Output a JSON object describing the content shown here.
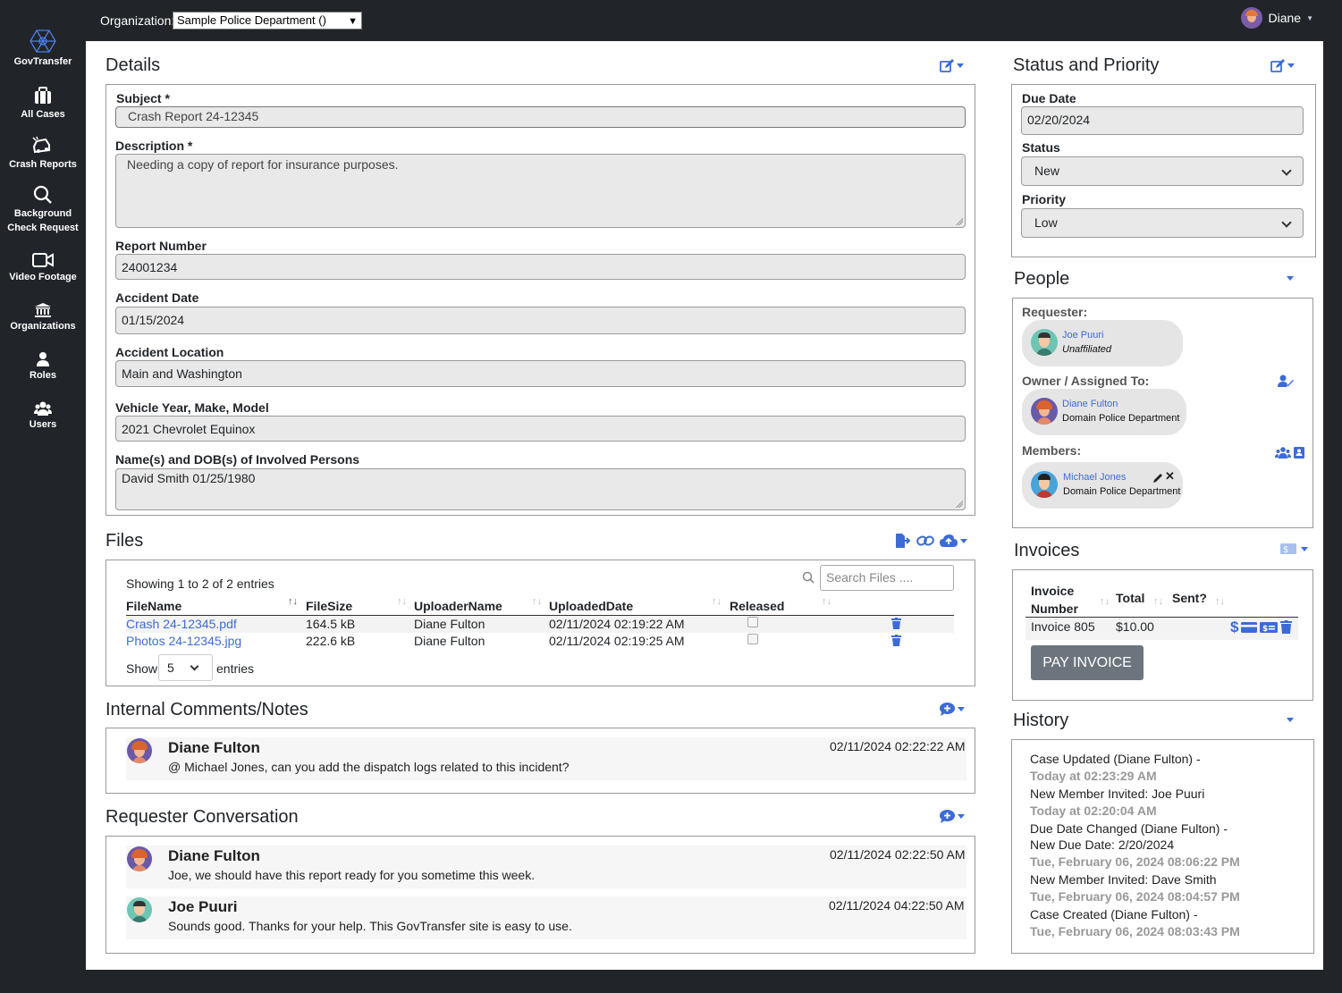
{
  "brand": "GovTransfer",
  "sidebar": {
    "items": [
      {
        "label": "All Cases",
        "icon": "briefcase-icon"
      },
      {
        "label": "Crash Reports",
        "icon": "car-crash-icon"
      },
      {
        "label": "Background Check Request",
        "label_line1": "Background",
        "label_line2": "Check Request",
        "icon": "search-icon"
      },
      {
        "label": "Video Footage",
        "icon": "video-camera-icon"
      },
      {
        "label": "Organizations",
        "icon": "building-icon"
      },
      {
        "label": "Roles",
        "icon": "user-role-icon"
      },
      {
        "label": "Users",
        "icon": "users-icon"
      }
    ]
  },
  "topbar": {
    "org_label": "Organization:",
    "org_selected": "Sample Police Department ()",
    "user_name": "Diane"
  },
  "details": {
    "title": "Details",
    "subject_label": "Subject *",
    "subject_value": "Crash Report 24-12345",
    "description_label": "Description *",
    "description_value": "Needing a copy of report for insurance purposes.",
    "report_number_label": "Report Number",
    "report_number_value": "24001234",
    "accident_date_label": "Accident Date",
    "accident_date_value": "01/15/2024",
    "accident_location_label": "Accident Location",
    "accident_location_value": "Main and Washington",
    "vehicle_label": "Vehicle Year, Make, Model",
    "vehicle_value": "2021 Chevrolet Equinox",
    "persons_label": "Name(s) and DOB(s) of Involved Persons",
    "persons_value": "David Smith 01/25/1980"
  },
  "files": {
    "title": "Files",
    "showing": "Showing 1 to 2 of 2 entries",
    "search_placeholder": "Search Files ....",
    "columns": [
      "FileName",
      "FileSize",
      "UploaderName",
      "UploadedDate",
      "Released"
    ],
    "rows": [
      {
        "name": "Crash 24-12345.pdf",
        "size": "164.5 kB",
        "uploader": "Diane Fulton",
        "date": "02/11/2024 02:19:22 AM"
      },
      {
        "name": "Photos 24-12345.jpg",
        "size": "222.6 kB",
        "uploader": "Diane Fulton",
        "date": "02/11/2024 02:19:25 AM"
      }
    ],
    "show_label": "Show",
    "page_size": "5",
    "entries_label": "entries"
  },
  "internal": {
    "title": "Internal Comments/Notes",
    "comments": [
      {
        "name": "Diane Fulton",
        "time": "02/11/2024 02:22:22 AM",
        "text": "@ Michael Jones, can you add the dispatch logs related to this incident?"
      }
    ]
  },
  "requester_conv": {
    "title": "Requester Conversation",
    "comments": [
      {
        "name": "Diane Fulton",
        "time": "02/11/2024 02:22:50 AM",
        "text": "Joe, we should have this report ready for you sometime this week."
      },
      {
        "name": "Joe Puuri",
        "time": "02/11/2024 04:22:50 AM",
        "text": "Sounds good. Thanks for your help. This GovTransfer site is easy to use."
      }
    ]
  },
  "status": {
    "title": "Status and Priority",
    "due_label": "Due Date",
    "due_value": "02/20/2024",
    "status_label": "Status",
    "status_value": "New",
    "priority_label": "Priority",
    "priority_value": "Low"
  },
  "people": {
    "title": "People",
    "requester_label": "Requester:",
    "requester": {
      "name": "Joe Puuri",
      "org": "Unaffiliated"
    },
    "owner_label": "Owner / Assigned To:",
    "owner": {
      "name": "Diane Fulton",
      "org": "Domain Police Department"
    },
    "members_label": "Members:",
    "member": {
      "name": "Michael Jones",
      "org": "Domain Police Department"
    }
  },
  "invoices": {
    "title": "Invoices",
    "col_invoice_1": "Invoice",
    "col_invoice_2": "Number",
    "col_total": "Total",
    "col_sent": "Sent?",
    "row": {
      "number": "Invoice 805",
      "total": "$10.00"
    },
    "pay_label": "PAY INVOICE"
  },
  "history": {
    "title": "History",
    "items": [
      {
        "title": "Case Updated (Diane Fulton) -",
        "time": "Today at 02:23:29 AM"
      },
      {
        "title": "New Member Invited: Joe Puuri",
        "time": "Today at 02:20:04 AM"
      },
      {
        "title": "Due Date Changed (Diane Fulton) -",
        "title2": "New Due Date: 2/20/2024",
        "time": "Tue, February 06, 2024 08:06:22 PM"
      },
      {
        "title": "New Member Invited: Dave Smith",
        "time": "Tue, February 06, 2024 08:04:57 PM"
      },
      {
        "title": "Case Created (Diane Fulton) -",
        "time": "Tue, February 06, 2024 08:03:43 PM"
      }
    ]
  },
  "colors": {
    "accent": "#3d6bd6",
    "dark": "#212529",
    "field_bg": "#e9e9e9"
  }
}
